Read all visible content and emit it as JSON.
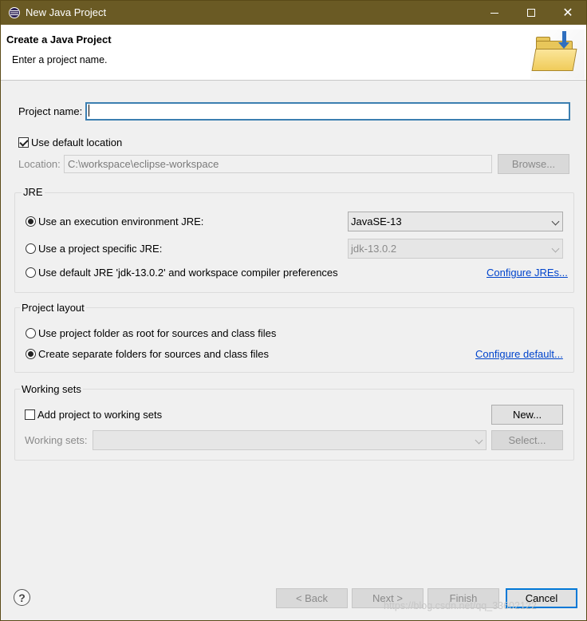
{
  "window": {
    "title": "New Java Project",
    "controls": {
      "minimize": "minimize",
      "maximize": "maximize",
      "close": "close"
    }
  },
  "banner": {
    "title": "Create a Java Project",
    "subtitle": "Enter a project name."
  },
  "project": {
    "name_label": "Project name:",
    "name_value": ""
  },
  "location": {
    "use_default_label": "Use default location",
    "use_default_checked": true,
    "location_label": "Location:",
    "location_value": "C:\\workspace\\eclipse-workspace",
    "browse_label": "Browse..."
  },
  "jre": {
    "group_label": "JRE",
    "option_execution_env": "Use an execution environment JRE:",
    "option_project_specific": "Use a project specific JRE:",
    "option_default": "Use default JRE 'jdk-13.0.2' and workspace compiler preferences",
    "selected_option": "execution_env",
    "execution_env_value": "JavaSE-13",
    "project_specific_value": "jdk-13.0.2",
    "configure_link": "Configure JREs..."
  },
  "layout": {
    "group_label": "Project layout",
    "option_root": "Use project folder as root for sources and class files",
    "option_separate": "Create separate folders for sources and class files",
    "selected_option": "separate",
    "configure_link": "Configure default..."
  },
  "working_sets": {
    "group_label": "Working sets",
    "add_label": "Add project to working sets",
    "add_checked": false,
    "new_label": "New...",
    "sets_label": "Working sets:",
    "sets_value": "",
    "select_label": "Select..."
  },
  "footer": {
    "help_glyph": "?",
    "back_label": "< Back",
    "next_label": "Next >",
    "finish_label": "Finish",
    "cancel_label": "Cancel"
  },
  "watermark": "https://blog.csdn.net/qq_33602122",
  "colors": {
    "titlebar": "#6a5a24",
    "link": "#0044cc",
    "focus_border": "#3c7fb1",
    "primary_button_border": "#0078d7"
  },
  "icons": {
    "app": "eclipse-icon",
    "wizard": "new-java-project-folder-icon",
    "help": "help-icon"
  }
}
